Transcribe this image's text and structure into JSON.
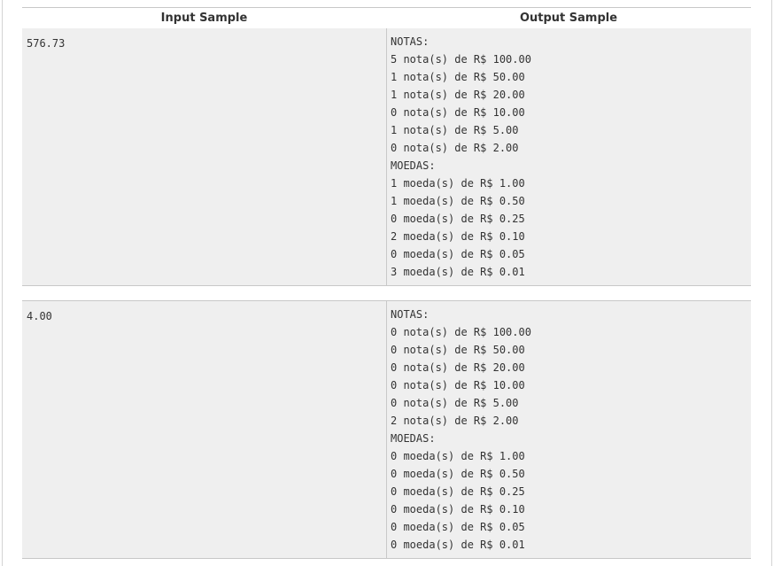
{
  "table": {
    "headers": {
      "input": "Input Sample",
      "output": "Output Sample"
    },
    "samples": [
      {
        "input": "576.73",
        "output": [
          "NOTAS:",
          "5 nota(s) de R$ 100.00",
          "1 nota(s) de R$ 50.00",
          "1 nota(s) de R$ 20.00",
          "0 nota(s) de R$ 10.00",
          "1 nota(s) de R$ 5.00",
          "0 nota(s) de R$ 2.00",
          "MOEDAS:",
          "1 moeda(s) de R$ 1.00",
          "1 moeda(s) de R$ 0.50",
          "0 moeda(s) de R$ 0.25",
          "2 moeda(s) de R$ 0.10",
          "0 moeda(s) de R$ 0.05",
          "3 moeda(s) de R$ 0.01"
        ]
      },
      {
        "input": "4.00",
        "output": [
          "NOTAS:",
          "0 nota(s) de R$ 100.00",
          "0 nota(s) de R$ 50.00",
          "0 nota(s) de R$ 20.00",
          "0 nota(s) de R$ 10.00",
          "0 nota(s) de R$ 5.00",
          "2 nota(s) de R$ 2.00",
          "MOEDAS:",
          "0 moeda(s) de R$ 1.00",
          "0 moeda(s) de R$ 0.50",
          "0 moeda(s) de R$ 0.25",
          "0 moeda(s) de R$ 0.10",
          "0 moeda(s) de R$ 0.05",
          "0 moeda(s) de R$ 0.01"
        ]
      }
    ]
  }
}
